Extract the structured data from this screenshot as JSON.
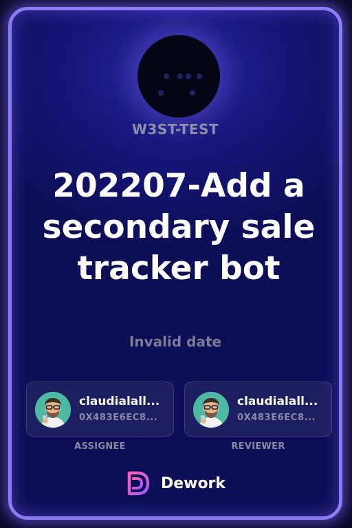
{
  "organization": {
    "name": "W3ST-TEST",
    "logo_icon": "dot-pattern-logo-icon"
  },
  "task": {
    "title": "202207-Add a secondary sale tracker bot",
    "date": "Invalid date"
  },
  "assignee": {
    "name": "claudialall...",
    "address": "0X483E6EC8...",
    "role_label": "ASSIGNEE",
    "avatar_icon": "avatar-bearded-person-icon"
  },
  "reviewer": {
    "name": "claudialall...",
    "address": "0X483E6EC8...",
    "role_label": "REVIEWER",
    "avatar_icon": "avatar-bearded-person-icon"
  },
  "brand": {
    "name": "Dework",
    "logo_icon": "dework-logo-icon"
  },
  "colors": {
    "card_border": "#8b7cf5",
    "card_background": "#16167a",
    "avatar_background": "#4db8a4",
    "muted_text": "#8e8ea8"
  }
}
